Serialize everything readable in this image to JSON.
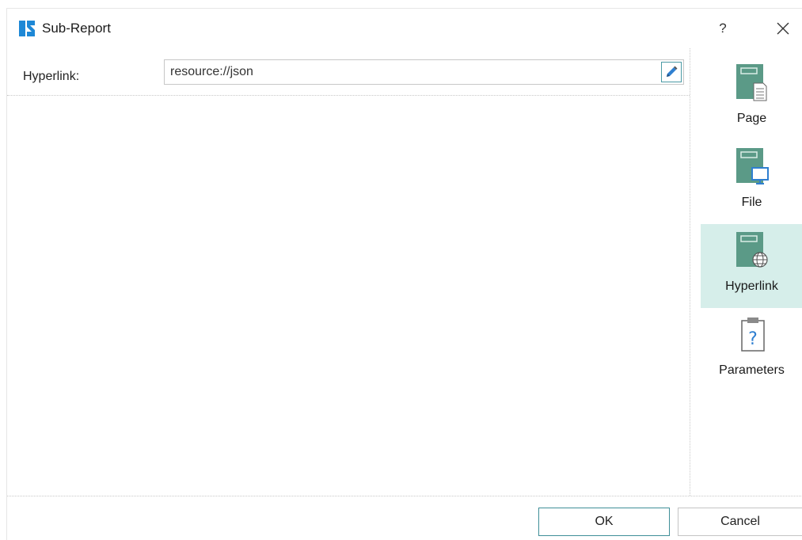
{
  "window": {
    "title": "Sub-Report",
    "help_label": "?",
    "logo_icon": "stimulsoft-logo-icon",
    "close_icon": "close-icon"
  },
  "hyperlink_field": {
    "label": "Hyperlink:",
    "value": "resource://json",
    "edit_icon": "pencil-icon"
  },
  "sidebar": {
    "items": [
      {
        "label": "Page",
        "icon": "page-document-icon",
        "selected": false
      },
      {
        "label": "File",
        "icon": "file-monitor-icon",
        "selected": false
      },
      {
        "label": "Hyperlink",
        "icon": "hyperlink-globe-icon",
        "selected": true
      },
      {
        "label": "Parameters",
        "icon": "parameters-clipboard-question-icon",
        "selected": false
      }
    ]
  },
  "footer": {
    "ok_label": "OK",
    "cancel_label": "Cancel"
  },
  "colors": {
    "accent": "#3f8f98",
    "selected_bg": "#d6eeea",
    "icon_green": "#5b9a87",
    "logo_blue": "#1e88d6"
  }
}
